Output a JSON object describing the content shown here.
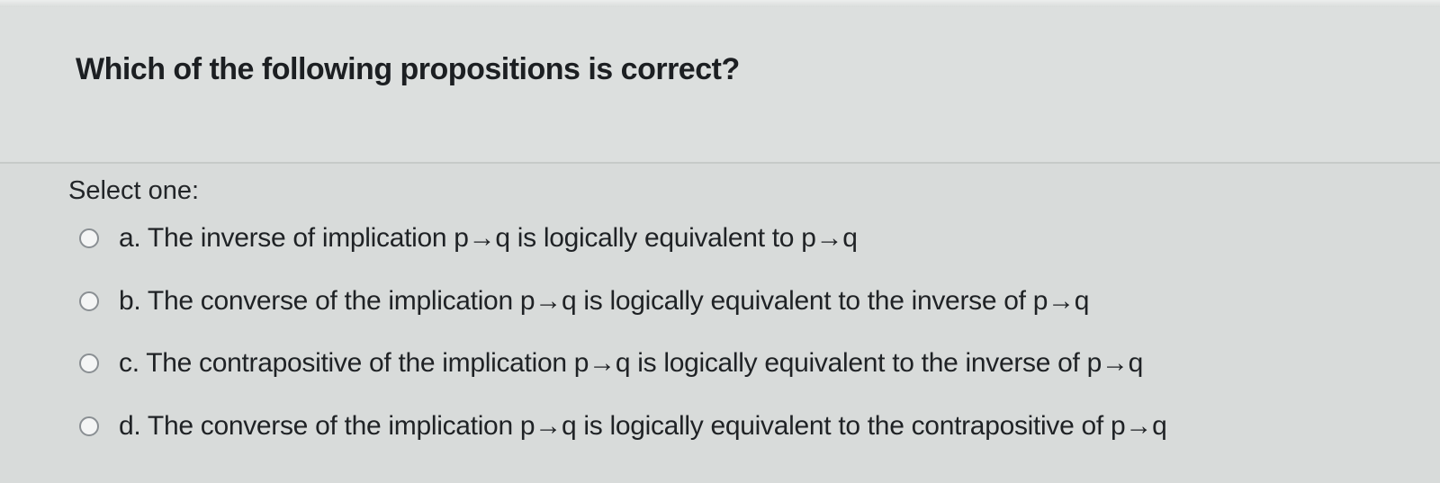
{
  "question": {
    "text": "Which of the following propositions is correct?"
  },
  "answer": {
    "prompt": "Select one:",
    "options": [
      {
        "label": "a. The inverse of implication p→q is logically equivalent to p→q",
        "selected": false
      },
      {
        "label": "b. The converse of the implication p→q is logically equivalent to the inverse of p→q",
        "selected": false
      },
      {
        "label": "c. The contrapositive of the implication p→q is logically equivalent to the inverse of p→q",
        "selected": false
      },
      {
        "label": "d. The converse of the implication p→q is logically equivalent to the contrapositive of p→q",
        "selected": false
      }
    ]
  }
}
